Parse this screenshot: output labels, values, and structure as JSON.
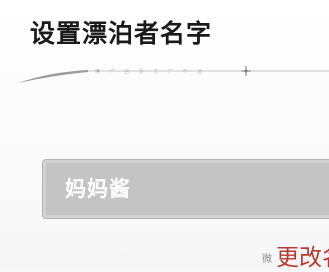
{
  "dialog": {
    "title": "设置漂泊者名字",
    "ornament_text": "鸣 广 自 逐 无 广 不 远"
  },
  "name_input": {
    "value": "妈妈酱"
  },
  "actions": {
    "change_label": "更改名"
  },
  "watermark": {
    "text": "微"
  },
  "colors": {
    "title": "#1a1a1a",
    "input_background": "#c4c4c4",
    "input_text": "#ffffff",
    "action_text": "#b83b33"
  }
}
